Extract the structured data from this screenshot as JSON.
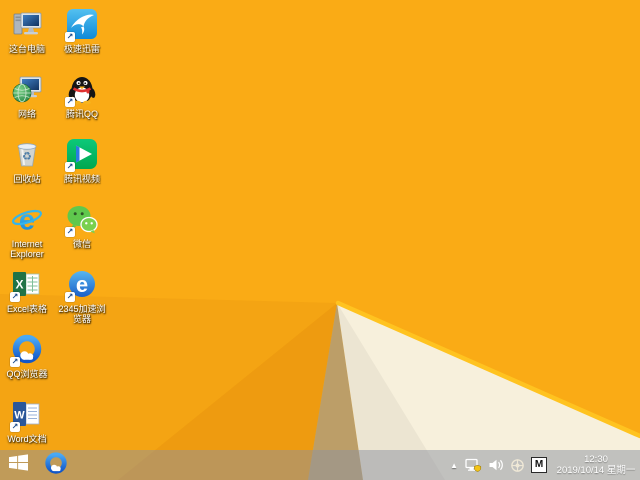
{
  "wallpaper": {
    "base": "#FAAB15",
    "facet_left_medium": "#F4A413",
    "facet_left_dark": "#EE9B10",
    "facet_tan": "#BC9E68",
    "facet_white": "#F7F0DC",
    "edge_highlight": "#FFC320"
  },
  "desktop": {
    "icons": [
      {
        "label": "这台电脑"
      },
      {
        "label": "网络"
      },
      {
        "label": "回收站"
      },
      {
        "label": "Internet Explorer"
      },
      {
        "label": "Excel表格"
      },
      {
        "label": "QQ浏览器"
      },
      {
        "label": "Word文档"
      },
      {
        "label": "极速迅雷"
      },
      {
        "label": "腾讯QQ"
      },
      {
        "label": "腾讯视频"
      },
      {
        "label": "微信"
      },
      {
        "label": "2345加速浏览器"
      }
    ]
  },
  "taskbar": {
    "input_indicator": "M",
    "clock": {
      "time": "12:30",
      "date": "2019/10/14 星期一"
    }
  }
}
